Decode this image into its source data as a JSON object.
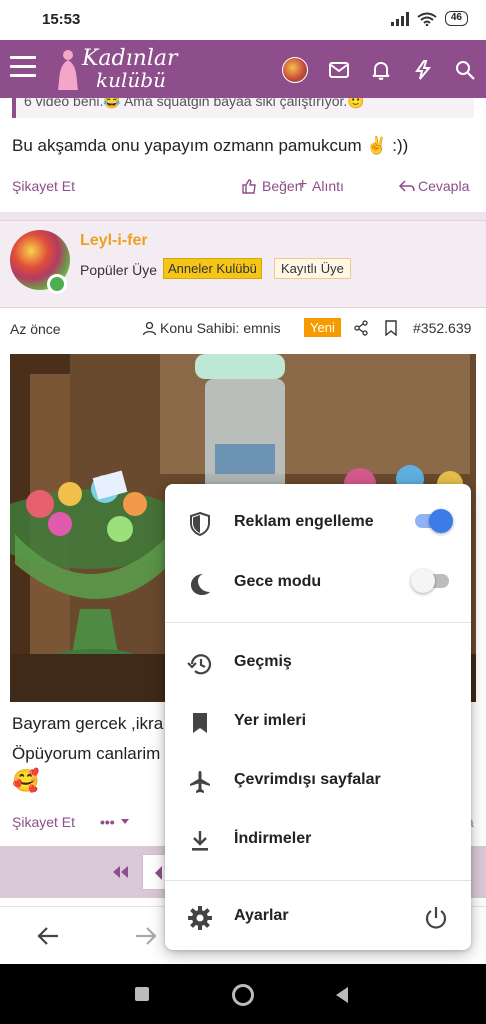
{
  "status_bar": {
    "time": "15:53",
    "battery": "46"
  },
  "header": {
    "logo_line1": "Kadınlar",
    "logo_line2": "kulübü"
  },
  "previous_post": {
    "quote_text": "6 video beni.😂 Ama squatgin bayaa siki çalıştırıyor.🙂",
    "text": "Bu akşamda onu yapayım ozmann pamukcum ✌️ :))",
    "report": "Şikayet Et",
    "like": "Beğen",
    "quote": "Alıntı",
    "reply": "Cevapla"
  },
  "post": {
    "username": "Leyl-i-fer",
    "role": "Popüler Üye",
    "badge_club": "Anneler Kulübü",
    "badge_registered": "Kayıtlı Üye",
    "time": "Az önce",
    "owner": "Konu Sahibi: emnis",
    "new_badge": "Yeni",
    "number": "#352.639",
    "text_line1": "Bayram gercek ,ikra",
    "text_line2": "Öpüyorum canlarim",
    "emoji": "🥰",
    "report": "Şikayet Et",
    "more": "•••",
    "reply_partial": "a"
  },
  "menu": {
    "ad_block": {
      "label": "Reklam engelleme",
      "on": true
    },
    "night_mode": {
      "label": "Gece modu",
      "on": false
    },
    "history": "Geçmiş",
    "bookmarks": "Yer imleri",
    "offline": "Çevrimdışı sayfalar",
    "downloads": "İndirmeler",
    "settings": "Ayarlar"
  },
  "colors": {
    "brand": "#8e4d8b",
    "toggle_on": "#3b7ce6",
    "badge_gold": "#f5c518",
    "badge_new": "#f59b00"
  }
}
